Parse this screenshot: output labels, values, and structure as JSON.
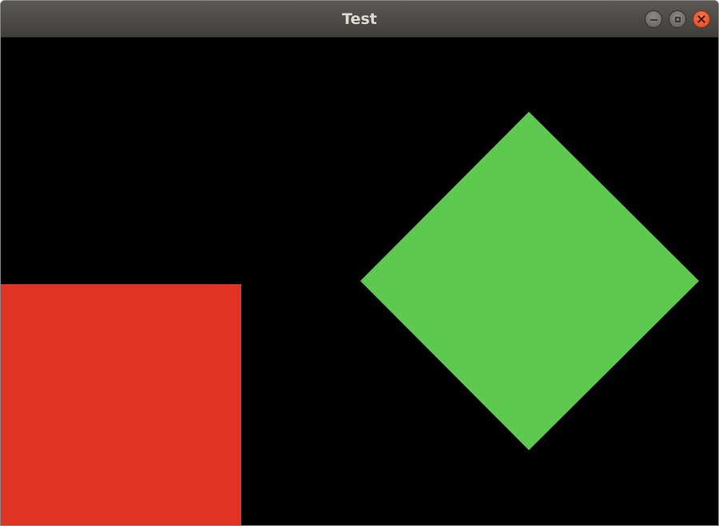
{
  "window": {
    "title": "Test",
    "controls": {
      "minimize": "minimize-icon",
      "maximize": "maximize-icon",
      "close": "close-icon"
    }
  },
  "canvas": {
    "background": "#000000",
    "shapes": [
      {
        "kind": "square",
        "color": "#e03324"
      },
      {
        "kind": "diamond",
        "color": "#5ec94f"
      }
    ]
  }
}
